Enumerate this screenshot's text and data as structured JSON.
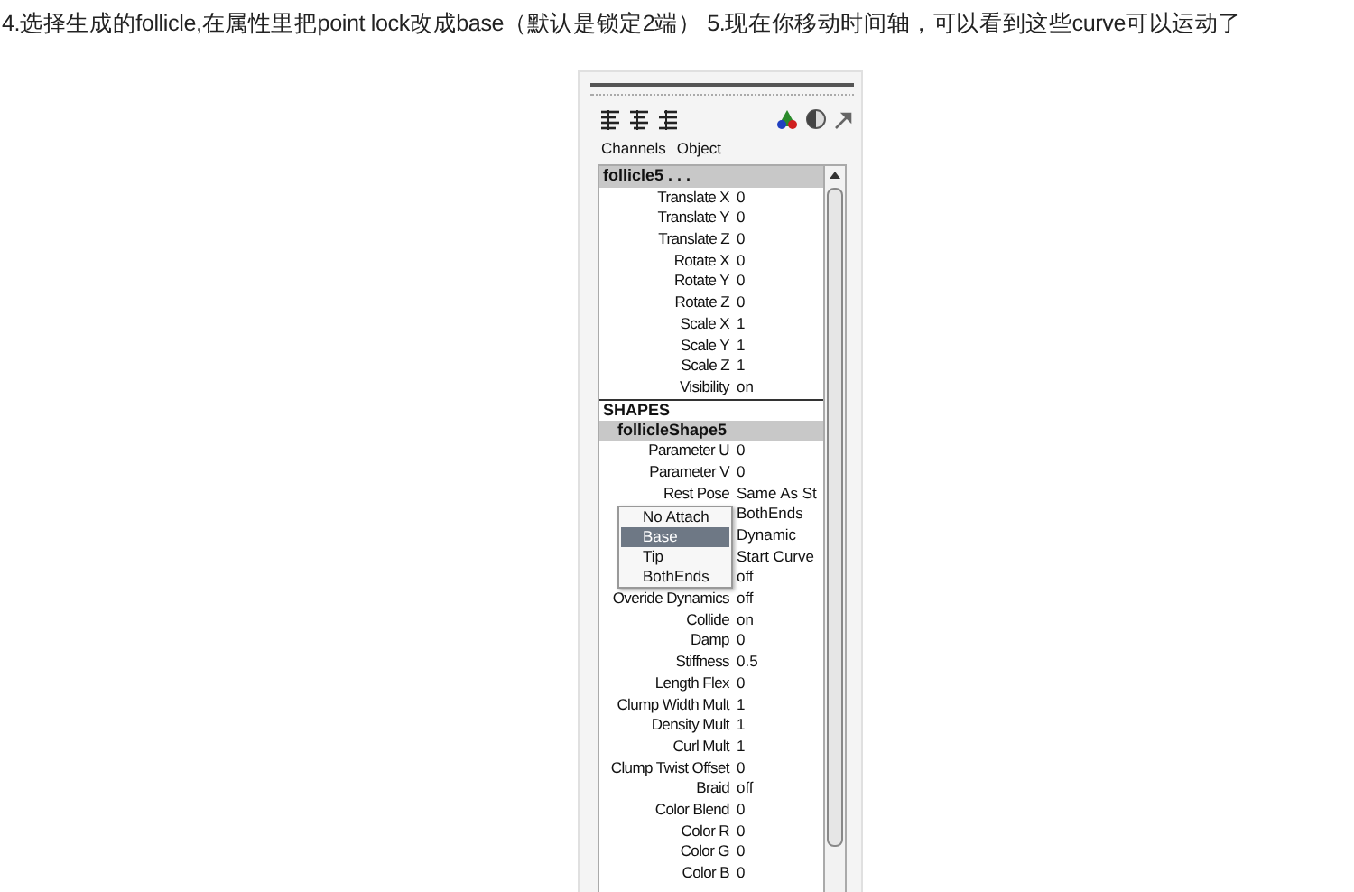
{
  "caption": "4.选择生成的follicle,在属性里把point lock改成base（默认是锁定2端） 5.现在你移动时间轴，可以看到这些curve可以运动了",
  "menu_labels": [
    {
      "label": "Channels"
    },
    {
      "label": "Object"
    }
  ],
  "channel_box": {
    "node": "follicle5 . . .",
    "node_attributes": [
      {
        "label": "Translate X",
        "value": "0"
      },
      {
        "label": "Translate Y",
        "value": "0"
      },
      {
        "label": "Translate Z",
        "value": "0"
      },
      {
        "label": "Rotate X",
        "value": "0"
      },
      {
        "label": "Rotate Y",
        "value": "0"
      },
      {
        "label": "Rotate Z",
        "value": "0"
      },
      {
        "label": "Scale X",
        "value": "1"
      },
      {
        "label": "Scale Y",
        "value": "1"
      },
      {
        "label": "Scale Z",
        "value": "1"
      },
      {
        "label": "Visibility",
        "value": "on"
      }
    ],
    "shapes_heading": "SHAPES",
    "shape_node": "follicleShape5",
    "shape_attributes": [
      {
        "label": "Parameter U",
        "value": "0"
      },
      {
        "label": "Parameter V",
        "value": "0"
      },
      {
        "label": "Rest Pose",
        "value": "Same As St"
      },
      {
        "value": "BothEnds"
      },
      {
        "value": "Dynamic"
      },
      {
        "value": "Start Curve"
      },
      {
        "value": "off"
      },
      {
        "label": "Overide Dynamics",
        "value": "off"
      },
      {
        "label": "Collide",
        "value": "on"
      },
      {
        "label": "Damp",
        "value": "0"
      },
      {
        "label": "Stiffness",
        "value": "0.5"
      },
      {
        "label": "Length Flex",
        "value": "0"
      },
      {
        "label": "Clump Width Mult",
        "value": "1"
      },
      {
        "label": "Density Mult",
        "value": "1"
      },
      {
        "label": "Curl Mult",
        "value": "1"
      },
      {
        "label": "Clump Twist Offset",
        "value": "0"
      },
      {
        "label": "Braid",
        "value": "off"
      },
      {
        "label": "Color Blend",
        "value": "0"
      },
      {
        "label": "Color R",
        "value": "0"
      },
      {
        "label": "Color G",
        "value": "0"
      },
      {
        "label": "Color B",
        "value": "0"
      }
    ]
  },
  "dropdown": {
    "items": [
      {
        "label": "No Attach",
        "selected": false
      },
      {
        "label": "Base",
        "selected": true
      },
      {
        "label": "Tip",
        "selected": false
      },
      {
        "label": "BothEnds",
        "selected": false
      }
    ]
  }
}
